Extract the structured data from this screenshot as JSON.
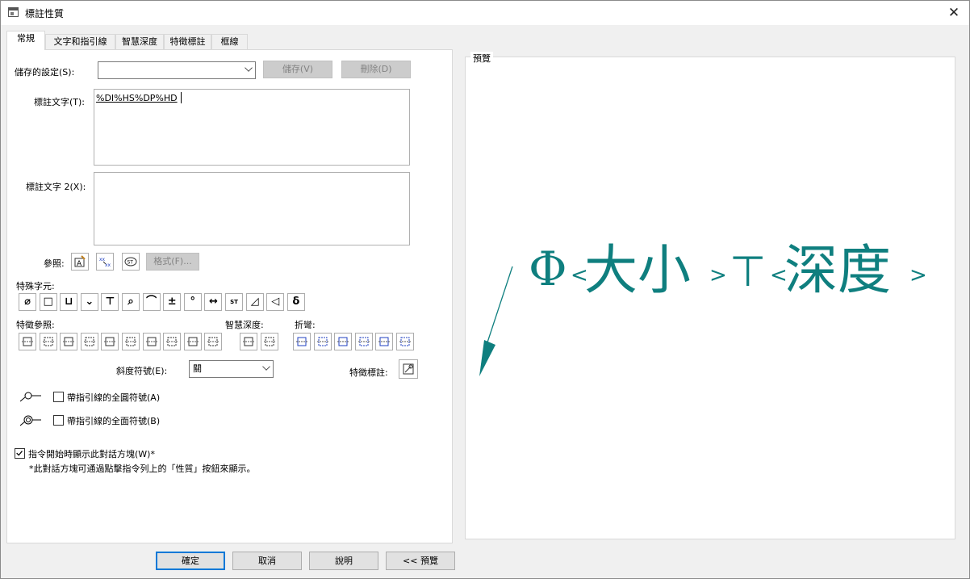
{
  "window": {
    "title": "標註性質",
    "close_glyph": "✕"
  },
  "tabs": [
    "常規",
    "文字和指引線",
    "智慧深度",
    "特徵標註",
    "框線"
  ],
  "general": {
    "saved_settings_label": "儲存的設定(S):",
    "saved_settings_value": "",
    "save_label": "儲存(V)",
    "delete_label": "刪除(D)",
    "callout_text_label": "標註文字(T):",
    "callout_text_value": "%DI%HS%DP%HD",
    "callout_text2_label": "標註文字 2(X):",
    "callout_text2_value": "",
    "reference_label": "參照:",
    "format_label": "格式(F)...",
    "special_chars_label": "特殊字元:",
    "special_chars": [
      "⌀",
      "□",
      "⊔",
      "⌄",
      "⊤",
      "⌕",
      "⌒",
      "±",
      "°",
      "↔",
      "ST",
      "◿",
      "◁",
      "δ"
    ],
    "feature_ref_label": "特徵參照:",
    "smart_depth_label": "智慧深度:",
    "bend_label": "折彎:",
    "chamfer_label": "斜度符號(E):",
    "chamfer_value": "關",
    "feature_callout_label": "特徵標註:",
    "all_around_label": "帶指引線的全圓符號(A)",
    "all_over_label": "帶指引線的全面符號(B)",
    "show_dialog_label": "指令開始時顯示此對話方塊(W)*",
    "note_text": "*此對話方塊可通過點擊指令列上的「性質」按鈕來顯示。"
  },
  "preview": {
    "label": "預覽",
    "text_phi": "Φ",
    "text_size": "大小",
    "text_depth_sym": "⊤",
    "text_depth": "深度",
    "color": "#0f7f7f"
  },
  "buttons": {
    "ok": "確定",
    "cancel": "取消",
    "help": "說明",
    "preview": "<< 預覽"
  },
  "icons": [
    "window-icon",
    "close-icon",
    "chevron-down-icon"
  ]
}
